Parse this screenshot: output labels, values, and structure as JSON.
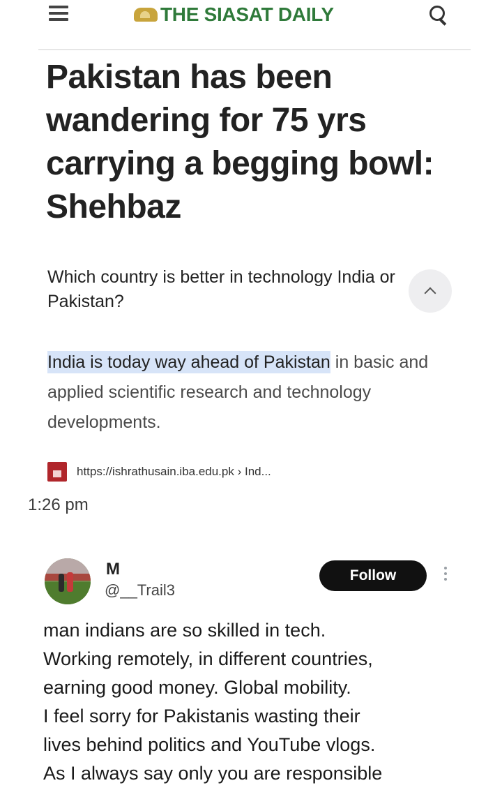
{
  "header": {
    "logo_text": "THE SIASAT DAILY",
    "menu_icon": "hamburger-icon",
    "search_icon": "search-icon",
    "brand_color": "#2f7a3a"
  },
  "article": {
    "headline": "Pakistan has been wandering for 75 yrs carrying a begging bowl: Shehbaz"
  },
  "snippet": {
    "question": "Which country is better in technology India or Pakistan?",
    "collapse_icon": "chevron-up-icon",
    "answer_highlight": "India is today way ahead of Pakistan",
    "answer_rest": " in basic and applied scientific research and technology developments.",
    "highlight_color": "#d7e4f8",
    "source_url": "https://ishrathusain.iba.edu.pk › Ind..."
  },
  "post": {
    "time": "1:26 pm"
  },
  "tweet": {
    "name": "M",
    "handle": "@__Trail3",
    "follow_label": "Follow",
    "more_icon": "more-vertical-icon",
    "text": "man indians are so skilled in tech.\nWorking remotely, in different countries,\nearning good money. Global mobility.\nI feel sorry for Pakistanis wasting their\nlives behind politics and YouTube vlogs.\nAs I always say only you are responsible"
  }
}
